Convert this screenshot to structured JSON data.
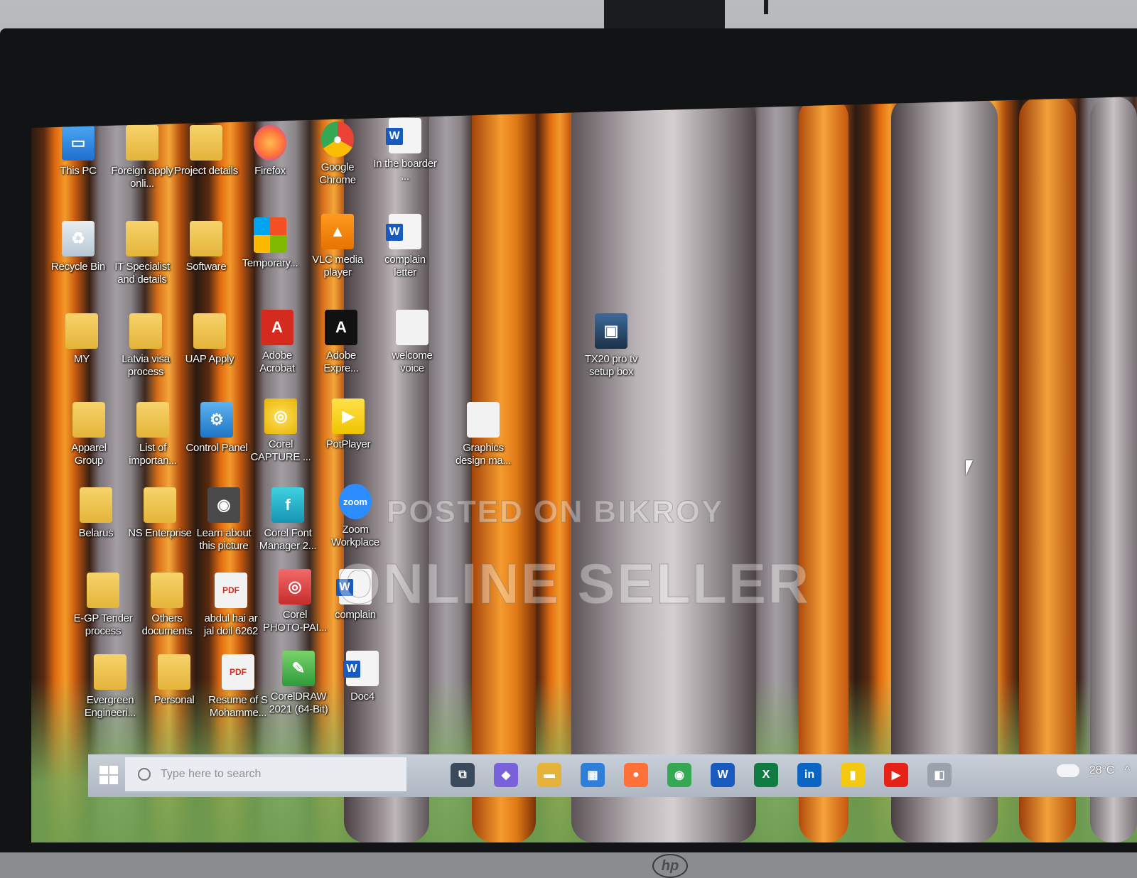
{
  "desktop": {
    "icons": [
      {
        "label": "This PC",
        "icon": "computer-icon",
        "kind": "pc"
      },
      {
        "label": "Foreign apply onli...",
        "icon": "folder-icon",
        "kind": "folder"
      },
      {
        "label": "Project details",
        "icon": "folder-icon",
        "kind": "folder"
      },
      {
        "label": "Firefox",
        "icon": "firefox-icon",
        "kind": "firefox"
      },
      {
        "label": "Google Chrome",
        "icon": "chrome-icon",
        "kind": "chrome"
      },
      {
        "label": "In the boarder ...",
        "icon": "word-document-icon",
        "kind": "word"
      },
      {
        "label": "Recycle Bin",
        "icon": "recycle-bin-icon",
        "kind": "recycle"
      },
      {
        "label": "IT Specialist and details",
        "icon": "folder-icon",
        "kind": "folder"
      },
      {
        "label": "Software",
        "icon": "folder-icon",
        "kind": "folder"
      },
      {
        "label": "Temporary...",
        "icon": "windows-installer-icon",
        "kind": "installer"
      },
      {
        "label": "VLC media player",
        "icon": "vlc-icon",
        "kind": "vlc"
      },
      {
        "label": "complain letter",
        "icon": "word-document-icon",
        "kind": "word"
      },
      {
        "label": "MY",
        "icon": "user-folder-icon",
        "kind": "folder"
      },
      {
        "label": "Latvia visa process",
        "icon": "folder-icon",
        "kind": "folder"
      },
      {
        "label": "UAP Apply",
        "icon": "folder-icon",
        "kind": "folder"
      },
      {
        "label": "Adobe Acrobat",
        "icon": "acrobat-icon",
        "kind": "acrobat"
      },
      {
        "label": "Adobe Expre...",
        "icon": "adobe-express-icon",
        "kind": "express"
      },
      {
        "label": "welcome voice",
        "icon": "document-icon",
        "kind": "doc"
      },
      {
        "label": "TX20 pro tv setup box",
        "icon": "image-file-icon",
        "kind": "image"
      },
      {
        "label": "Apparel Group",
        "icon": "folder-icon",
        "kind": "folder"
      },
      {
        "label": "List of importan...",
        "icon": "folder-icon",
        "kind": "folder"
      },
      {
        "label": "Control Panel",
        "icon": "control-panel-icon",
        "kind": "control"
      },
      {
        "label": "Corel CAPTURE ...",
        "icon": "corel-capture-icon",
        "kind": "capture"
      },
      {
        "label": "PotPlayer",
        "icon": "potplayer-icon",
        "kind": "potplayer"
      },
      {
        "label": "Graphics design ma...",
        "icon": "document-icon",
        "kind": "doc"
      },
      {
        "label": "Belarus",
        "icon": "folder-icon",
        "kind": "folder"
      },
      {
        "label": "NS Enterprise",
        "icon": "folder-icon",
        "kind": "folder"
      },
      {
        "label": "Learn about this picture",
        "icon": "camera-icon",
        "kind": "learn"
      },
      {
        "label": "Corel Font Manager 2...",
        "icon": "corel-font-icon",
        "kind": "font"
      },
      {
        "label": "Zoom Workplace",
        "icon": "zoom-icon",
        "kind": "zoom"
      },
      {
        "label": "E-GP Tender process",
        "icon": "folder-icon",
        "kind": "folder"
      },
      {
        "label": "Others documents",
        "icon": "folder-icon",
        "kind": "folder"
      },
      {
        "label": "abdul hai ar jal doil 6262",
        "icon": "pdf-icon",
        "kind": "pdf"
      },
      {
        "label": "Corel PHOTO-PAI...",
        "icon": "corel-photo-paint-icon",
        "kind": "photopaint"
      },
      {
        "label": "complain",
        "icon": "word-document-icon",
        "kind": "word"
      },
      {
        "label": "Evergreen Engineeri...",
        "icon": "folder-icon",
        "kind": "folder"
      },
      {
        "label": "Personal",
        "icon": "folder-icon",
        "kind": "folder"
      },
      {
        "label": "Resume of S Mohamme...",
        "icon": "pdf-icon",
        "kind": "pdf"
      },
      {
        "label": "CorelDRAW 2021 (64-Bit)",
        "icon": "coreldraw-icon",
        "kind": "coreldraw"
      },
      {
        "label": "Doc4",
        "icon": "word-document-icon",
        "kind": "word"
      }
    ]
  },
  "watermark": {
    "line1": "POSTED ON BIKROY",
    "line2": "ONLINE SELLER"
  },
  "taskbar": {
    "search_placeholder": "Type here to search",
    "apps": [
      {
        "name": "task-view-icon",
        "glyph": "⧉",
        "color": "#3a4a5c"
      },
      {
        "name": "copilot-icon",
        "glyph": "◆",
        "color": "#7b61d9"
      },
      {
        "name": "file-explorer-icon",
        "glyph": "▬",
        "color": "#e6b33a"
      },
      {
        "name": "microsoft-store-icon",
        "glyph": "▦",
        "color": "#2f7fd8"
      },
      {
        "name": "firefox-icon",
        "glyph": "●",
        "color": "#ff7139"
      },
      {
        "name": "chrome-icon",
        "glyph": "◉",
        "color": "#34a853"
      },
      {
        "name": "word-icon",
        "glyph": "W",
        "color": "#185abd"
      },
      {
        "name": "excel-icon",
        "glyph": "X",
        "color": "#107c41"
      },
      {
        "name": "linkedin-icon",
        "glyph": "in",
        "color": "#0a66c2"
      },
      {
        "name": "power-bi-icon",
        "glyph": "▮",
        "color": "#f2c811"
      },
      {
        "name": "youtube-icon",
        "glyph": "▶",
        "color": "#e62117"
      },
      {
        "name": "app-icon",
        "glyph": "◧",
        "color": "#9aa3ad"
      }
    ],
    "weather": "28°C",
    "tray_chevron": "^"
  },
  "monitor": {
    "brand": "hp"
  }
}
